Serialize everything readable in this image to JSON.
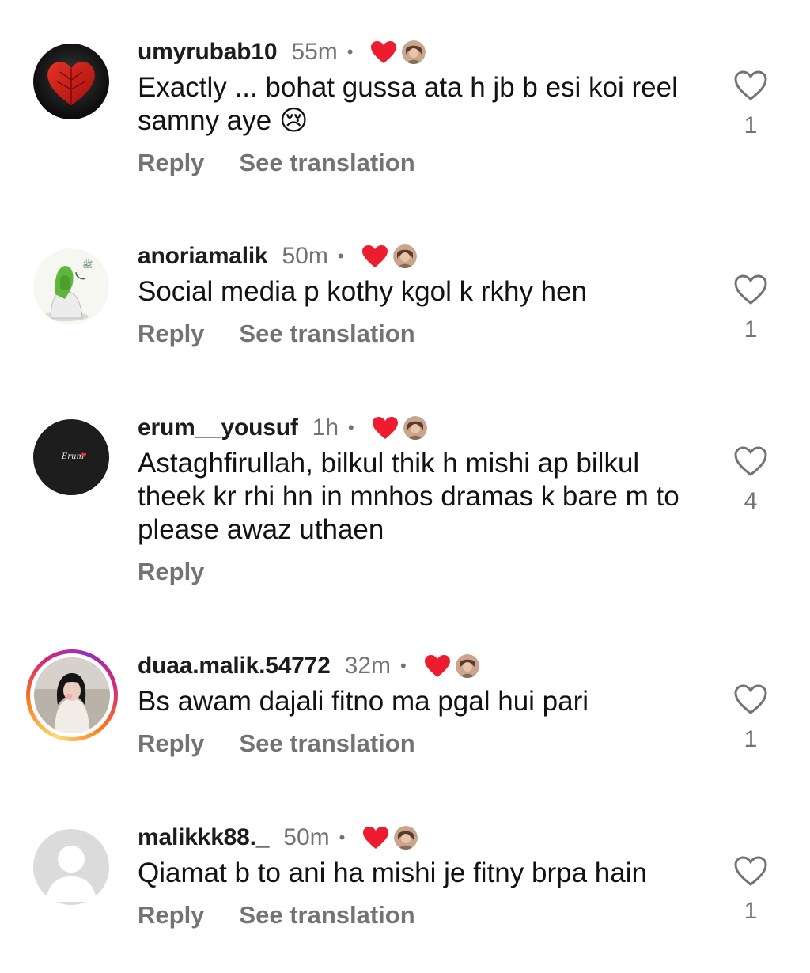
{
  "comments": [
    {
      "username": "umyrubab10",
      "time": "55m",
      "dot": "•",
      "text": "Exactly ... bohat gussa ata h jb b esi koi reel samny aye 😢",
      "reply_label": "Reply",
      "translation_label": "See translation",
      "like_count": "1",
      "avatar_icon": "red-leaf-heart-avatar"
    },
    {
      "username": "anoriamalik",
      "time": "50m",
      "dot": "•",
      "text": "Social media p kothy kgol k rkhy hen",
      "reply_label": "Reply",
      "translation_label": "See translation",
      "like_count": "1",
      "avatar_icon": "green-hijab-girl-avatar"
    },
    {
      "username": "erum__yousuf",
      "time": "1h",
      "dot": "•",
      "text": "Astaghfirullah,  bilkul thik h mishi ap bilkul theek kr rhi hn in mnhos dramas k bare m to please awaz uthaen",
      "reply_label": "Reply",
      "like_count": "4",
      "avatar_icon": "dark-signature-avatar"
    },
    {
      "username": "duaa.malik.54772",
      "time": "32m",
      "dot": "•",
      "text": "Bs awam dajali fitno ma pgal hui pari",
      "reply_label": "Reply",
      "translation_label": "See translation",
      "like_count": "1",
      "avatar_icon": "girl-photo-story-avatar"
    },
    {
      "username": "malikkk88._",
      "time": "50m",
      "dot": "•",
      "text": "Qiamat b to ani ha mishi je fitny brpa hain",
      "reply_label": "Reply",
      "translation_label": "See translation",
      "like_count": "1",
      "avatar_icon": "default-avatar"
    }
  ],
  "colors": {
    "heart_red": "#ed1c2e",
    "muted_gray": "#737373",
    "text_dark": "#121212"
  }
}
